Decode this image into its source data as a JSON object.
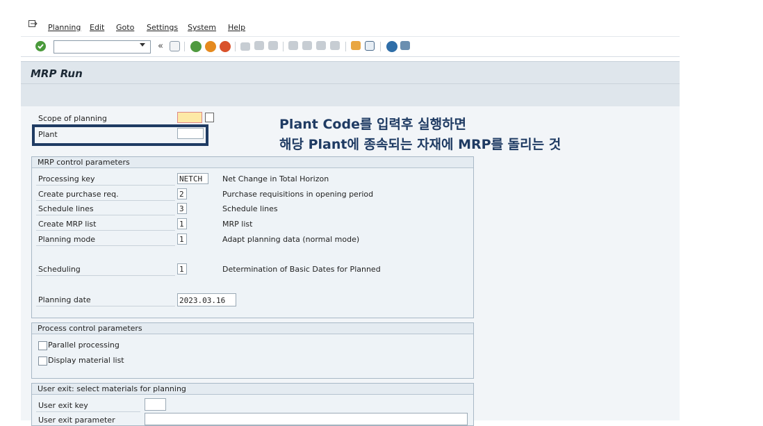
{
  "menu": {
    "items": [
      "Planning",
      "Edit",
      "Goto",
      "Settings",
      "System",
      "Help"
    ]
  },
  "toolbar": {
    "command_value": "",
    "icons": [
      "enter-icon",
      "save-icon",
      "back-icon",
      "exit-icon",
      "cancel-icon",
      "print-icon",
      "find-icon",
      "find-next-icon",
      "first-page-icon",
      "prev-page-icon",
      "next-page-icon",
      "last-page-icon",
      "new-session-icon",
      "shortcut-icon",
      "help-icon",
      "customize-icon"
    ]
  },
  "header": {
    "title": "MRP Run"
  },
  "scope": {
    "scope_label": "Scope of planning",
    "plant_label": "Plant",
    "scope_value": "",
    "plant_value": ""
  },
  "annotation": {
    "line1": "Plant Code를 입력후 실행하면",
    "line2": "해당 Plant에 종속되는 자재에 MRP를 돌리는 것"
  },
  "mrp_control": {
    "title": "MRP control parameters",
    "rows": [
      {
        "label": "Processing key",
        "value": "NETCH",
        "desc": "Net Change in Total Horizon"
      },
      {
        "label": "Create purchase req.",
        "value": "2",
        "desc": "Purchase requisitions in opening period"
      },
      {
        "label": "Schedule lines",
        "value": "3",
        "desc": "Schedule lines"
      },
      {
        "label": "Create MRP list",
        "value": "1",
        "desc": "MRP list"
      },
      {
        "label": "Planning mode",
        "value": "1",
        "desc": "Adapt planning data (normal mode)"
      },
      {
        "label": "Scheduling",
        "value": "1",
        "desc": "Determination of Basic Dates for Planned"
      },
      {
        "label": "Planning date",
        "value": "2023.03.16",
        "desc": ""
      }
    ]
  },
  "process_control": {
    "title": "Process control parameters",
    "parallel_label": "Parallel processing",
    "display_label": "Display material list"
  },
  "user_exit": {
    "title": "User exit: select materials for planning",
    "key_label": "User exit key",
    "param_label": "User exit parameter"
  }
}
